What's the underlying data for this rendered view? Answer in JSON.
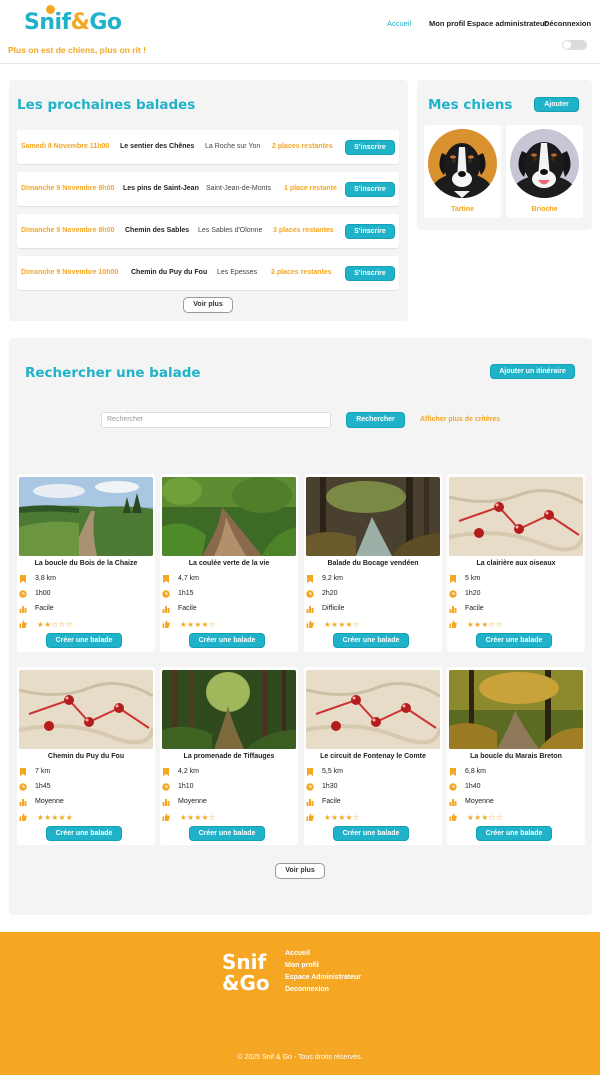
{
  "brand": {
    "logo_part1": "Snif",
    "logo_amp": "&",
    "logo_part2": "Go",
    "tagline": "Plus on est de chiens, plus on rit !"
  },
  "nav": {
    "items": [
      "Accueil",
      "Mon profil",
      "Espace administrateur",
      "Déconnexion"
    ],
    "active": "Accueil"
  },
  "upcoming": {
    "title": "Les prochaines balades",
    "button_label": "S'inscrire",
    "more_label": "Voir plus",
    "walks": [
      {
        "date": "Samedi 8 Novembre 11h00",
        "name": "Le sentier des Chênes",
        "city": "La Roche sur Yon",
        "places": "2 places restantes"
      },
      {
        "date": "Dimanche 9 Novembre 9h00",
        "name": "Les pins de Saint-Jean",
        "city": "Saint-Jean-de-Monts",
        "places": "1 place restante"
      },
      {
        "date": "Dimanche 9 Novembre 9h00",
        "name": "Chemin des Sables",
        "city": "Les Sables d'Olonne",
        "places": "3 places restantes"
      },
      {
        "date": "Dimanche 9 Novembre 10h00",
        "name": "Chemin du Puy du Fou",
        "city": "Les Epesses",
        "places": "2 places restantes"
      }
    ]
  },
  "dogs": {
    "title": "Mes chiens",
    "add_label": "Ajouter",
    "items": [
      {
        "name": "Tartine"
      },
      {
        "name": "Brioche"
      }
    ]
  },
  "search": {
    "title": "Rechercher une balade",
    "add_itinerary_label": "Ajouter un itinéraire",
    "placeholder": "Rechercher",
    "search_label": "Rechercher",
    "criteria_label": "Afficher plus de critères",
    "card_button_label": "Créer une balade",
    "more_label": "Voir plus",
    "cards": [
      {
        "title": "La boucle du Bois de la Chaize",
        "distance": "3,8 km",
        "duration": "1h00",
        "level": "Facile",
        "rating": 2,
        "image": "field-path"
      },
      {
        "title": "La coulée verte de la vie",
        "distance": "4,7 km",
        "duration": "1h15",
        "level": "Facile",
        "rating": 4,
        "image": "forest-stream"
      },
      {
        "title": "Balade du Bocage vendéen",
        "distance": "9,2 km",
        "duration": "2h20",
        "level": "Difficile",
        "rating": 4,
        "image": "forest-creek"
      },
      {
        "title": "La clairière aux oiseaux",
        "distance": "5 km",
        "duration": "1h20",
        "level": "Facile",
        "rating": 3,
        "image": "map-pins"
      },
      {
        "title": "Chemin du Puy du Fou",
        "distance": "7 km",
        "duration": "1h45",
        "level": "Moyenne",
        "rating": 5,
        "image": "map-pins"
      },
      {
        "title": "La promenade de Tiffauges",
        "distance": "4,2 km",
        "duration": "1h10",
        "level": "Moyenne",
        "rating": 4,
        "image": "forest-path"
      },
      {
        "title": "Le circuit de Fontenay le Comte",
        "distance": "5,5 km",
        "duration": "1h30",
        "level": "Facile",
        "rating": 4,
        "image": "map-pins"
      },
      {
        "title": "La boucle du Marais Breton",
        "distance": "6,8 km",
        "duration": "1h40",
        "level": "Moyenne",
        "rating": 3,
        "image": "autumn-path"
      }
    ]
  },
  "footer": {
    "logo_line1": "Snif",
    "logo_line2": "&Go",
    "links": [
      "Accueil",
      "Mon profil",
      "Espace Administrateur",
      "Deconnexion"
    ],
    "copyright": "© 2025 Snif & Go - Tous droits réservés."
  },
  "colors": {
    "accent": "#1fb2c8",
    "secondary": "#f5a623",
    "panel": "#f4f4f4"
  }
}
